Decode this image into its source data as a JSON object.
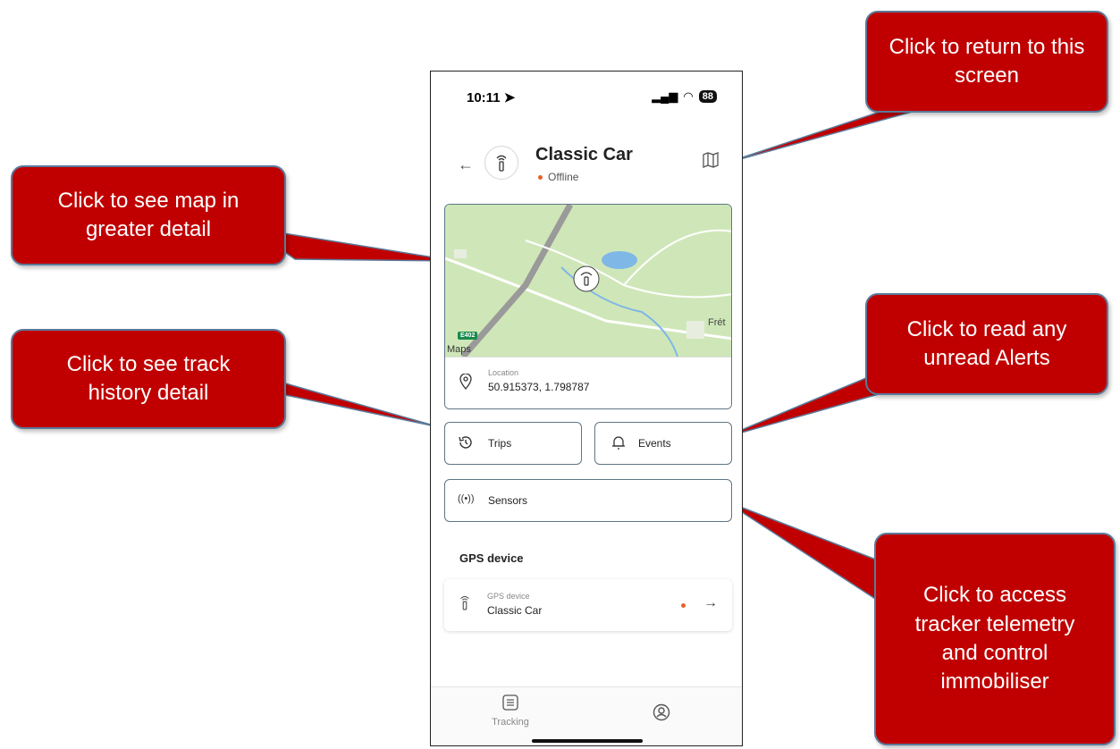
{
  "status_bar": {
    "time": "10:11",
    "battery": "88"
  },
  "header": {
    "title": "Classic Car",
    "status": "Offline"
  },
  "map": {
    "label_road": "E402",
    "label_town": "Frét",
    "attribution": "Maps"
  },
  "location": {
    "label": "Location",
    "value": "50.915373, 1.798787"
  },
  "buttons": {
    "trips": "Trips",
    "events": "Events",
    "sensors": "Sensors"
  },
  "gps_section": {
    "title": "GPS device",
    "device_label": "GPS device",
    "device_name": "Classic Car"
  },
  "tabbar": {
    "tracking": "Tracking"
  },
  "callouts": {
    "return": "Click to return to this screen",
    "map": "Click to see map in greater detail",
    "track": "Click to see track history detail",
    "alerts": "Click to read any unread Alerts",
    "telemetry": "Click to access tracker telemetry and control immobiliser"
  },
  "colors": {
    "callout": "#c00000",
    "card_border": "#5f7685",
    "offline_dot": "#e8602c",
    "map_green": "#cfe7b8"
  }
}
